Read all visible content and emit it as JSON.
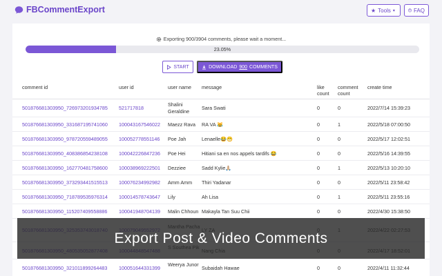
{
  "app": {
    "title": "FBCommentExport"
  },
  "header": {
    "tools_label": "Tools",
    "faq_label": "FAQ"
  },
  "status": {
    "message": "Exporting 900/3904 comments, please wait a moment...",
    "progress_label": "23.05%",
    "progress_fraction": 0.2305
  },
  "actions": {
    "start_label": "START",
    "download_prefix": "DOWNLOAD",
    "download_count": "900",
    "download_suffix": "COMMENTS"
  },
  "table": {
    "headers": [
      "comment id",
      "user id",
      "user name",
      "message",
      "like count",
      "comment count",
      "create time"
    ],
    "rows": [
      [
        "501876681303950_726973201934785",
        "521717818",
        "Shalini Geraldine",
        "Sara Swati",
        "0",
        "0",
        "2022/7/14 15:39:23"
      ],
      [
        "501876681303950_331687195741060",
        "100043167546022",
        "Maezz Rava",
        "RA VA 😹",
        "0",
        "1",
        "2022/5/18 07:00:50"
      ],
      [
        "501876681303950_978720559489055",
        "100052778551146",
        "Poe Jah",
        "Lenaelle😂😁",
        "0",
        "0",
        "2022/5/17 12:02:51"
      ],
      [
        "501876681303950_408386854238108",
        "100042226847236",
        "Poe Hei",
        "Hitiani sa en nos appels tardifs 😂",
        "0",
        "0",
        "2022/5/16 14:39:55"
      ],
      [
        "501876681303950_162770481758600",
        "100038969222501",
        "Dezziee",
        "Sadd Kylie🙏🏼",
        "0",
        "1",
        "2022/5/13 10:20:10"
      ],
      [
        "501876681303950_373293441515513",
        "100076234992982",
        "Amm Amm",
        "Thiri Yadanar",
        "0",
        "0",
        "2022/5/11 23:58:42"
      ],
      [
        "501876681303950_718789535976314",
        "100014578743647",
        "Lily",
        "Ah Lisa",
        "0",
        "1",
        "2022/5/11 23:55:16"
      ],
      [
        "501876681303950_115207409558886",
        "100041948704139",
        "Malin Chhoun",
        "Makayla Tan Suu Chii",
        "0",
        "0",
        "2022/4/30 15:38:50"
      ],
      [
        "501876681303950_325353743018740",
        "100079049552972",
        "Mantha Pacha",
        "LY ZA",
        "0",
        "1",
        "2022/4/22 02:27:53"
      ],
      [
        "501876681303950_480535052877408",
        "100044848547488",
        "S Southea Pik",
        "Nang Chia",
        "0",
        "0",
        "2022/4/17 18:52:01"
      ],
      [
        "501876681303950_321011899264483",
        "100051644331399",
        "Weerya Junor",
        "Subaidah Hawae",
        "0",
        "0",
        "2022/4/11 11:32:44"
      ]
    ]
  },
  "banner": {
    "text": "Export Post & Video Comments"
  },
  "colors": {
    "accent": "#7b57d6",
    "background": "#f3f3f7"
  },
  "icons": [
    "chat-bubble-icon",
    "star-icon",
    "chevron-down-icon",
    "question-circle-icon",
    "gear-icon",
    "play-outline-icon",
    "download-icon"
  ]
}
